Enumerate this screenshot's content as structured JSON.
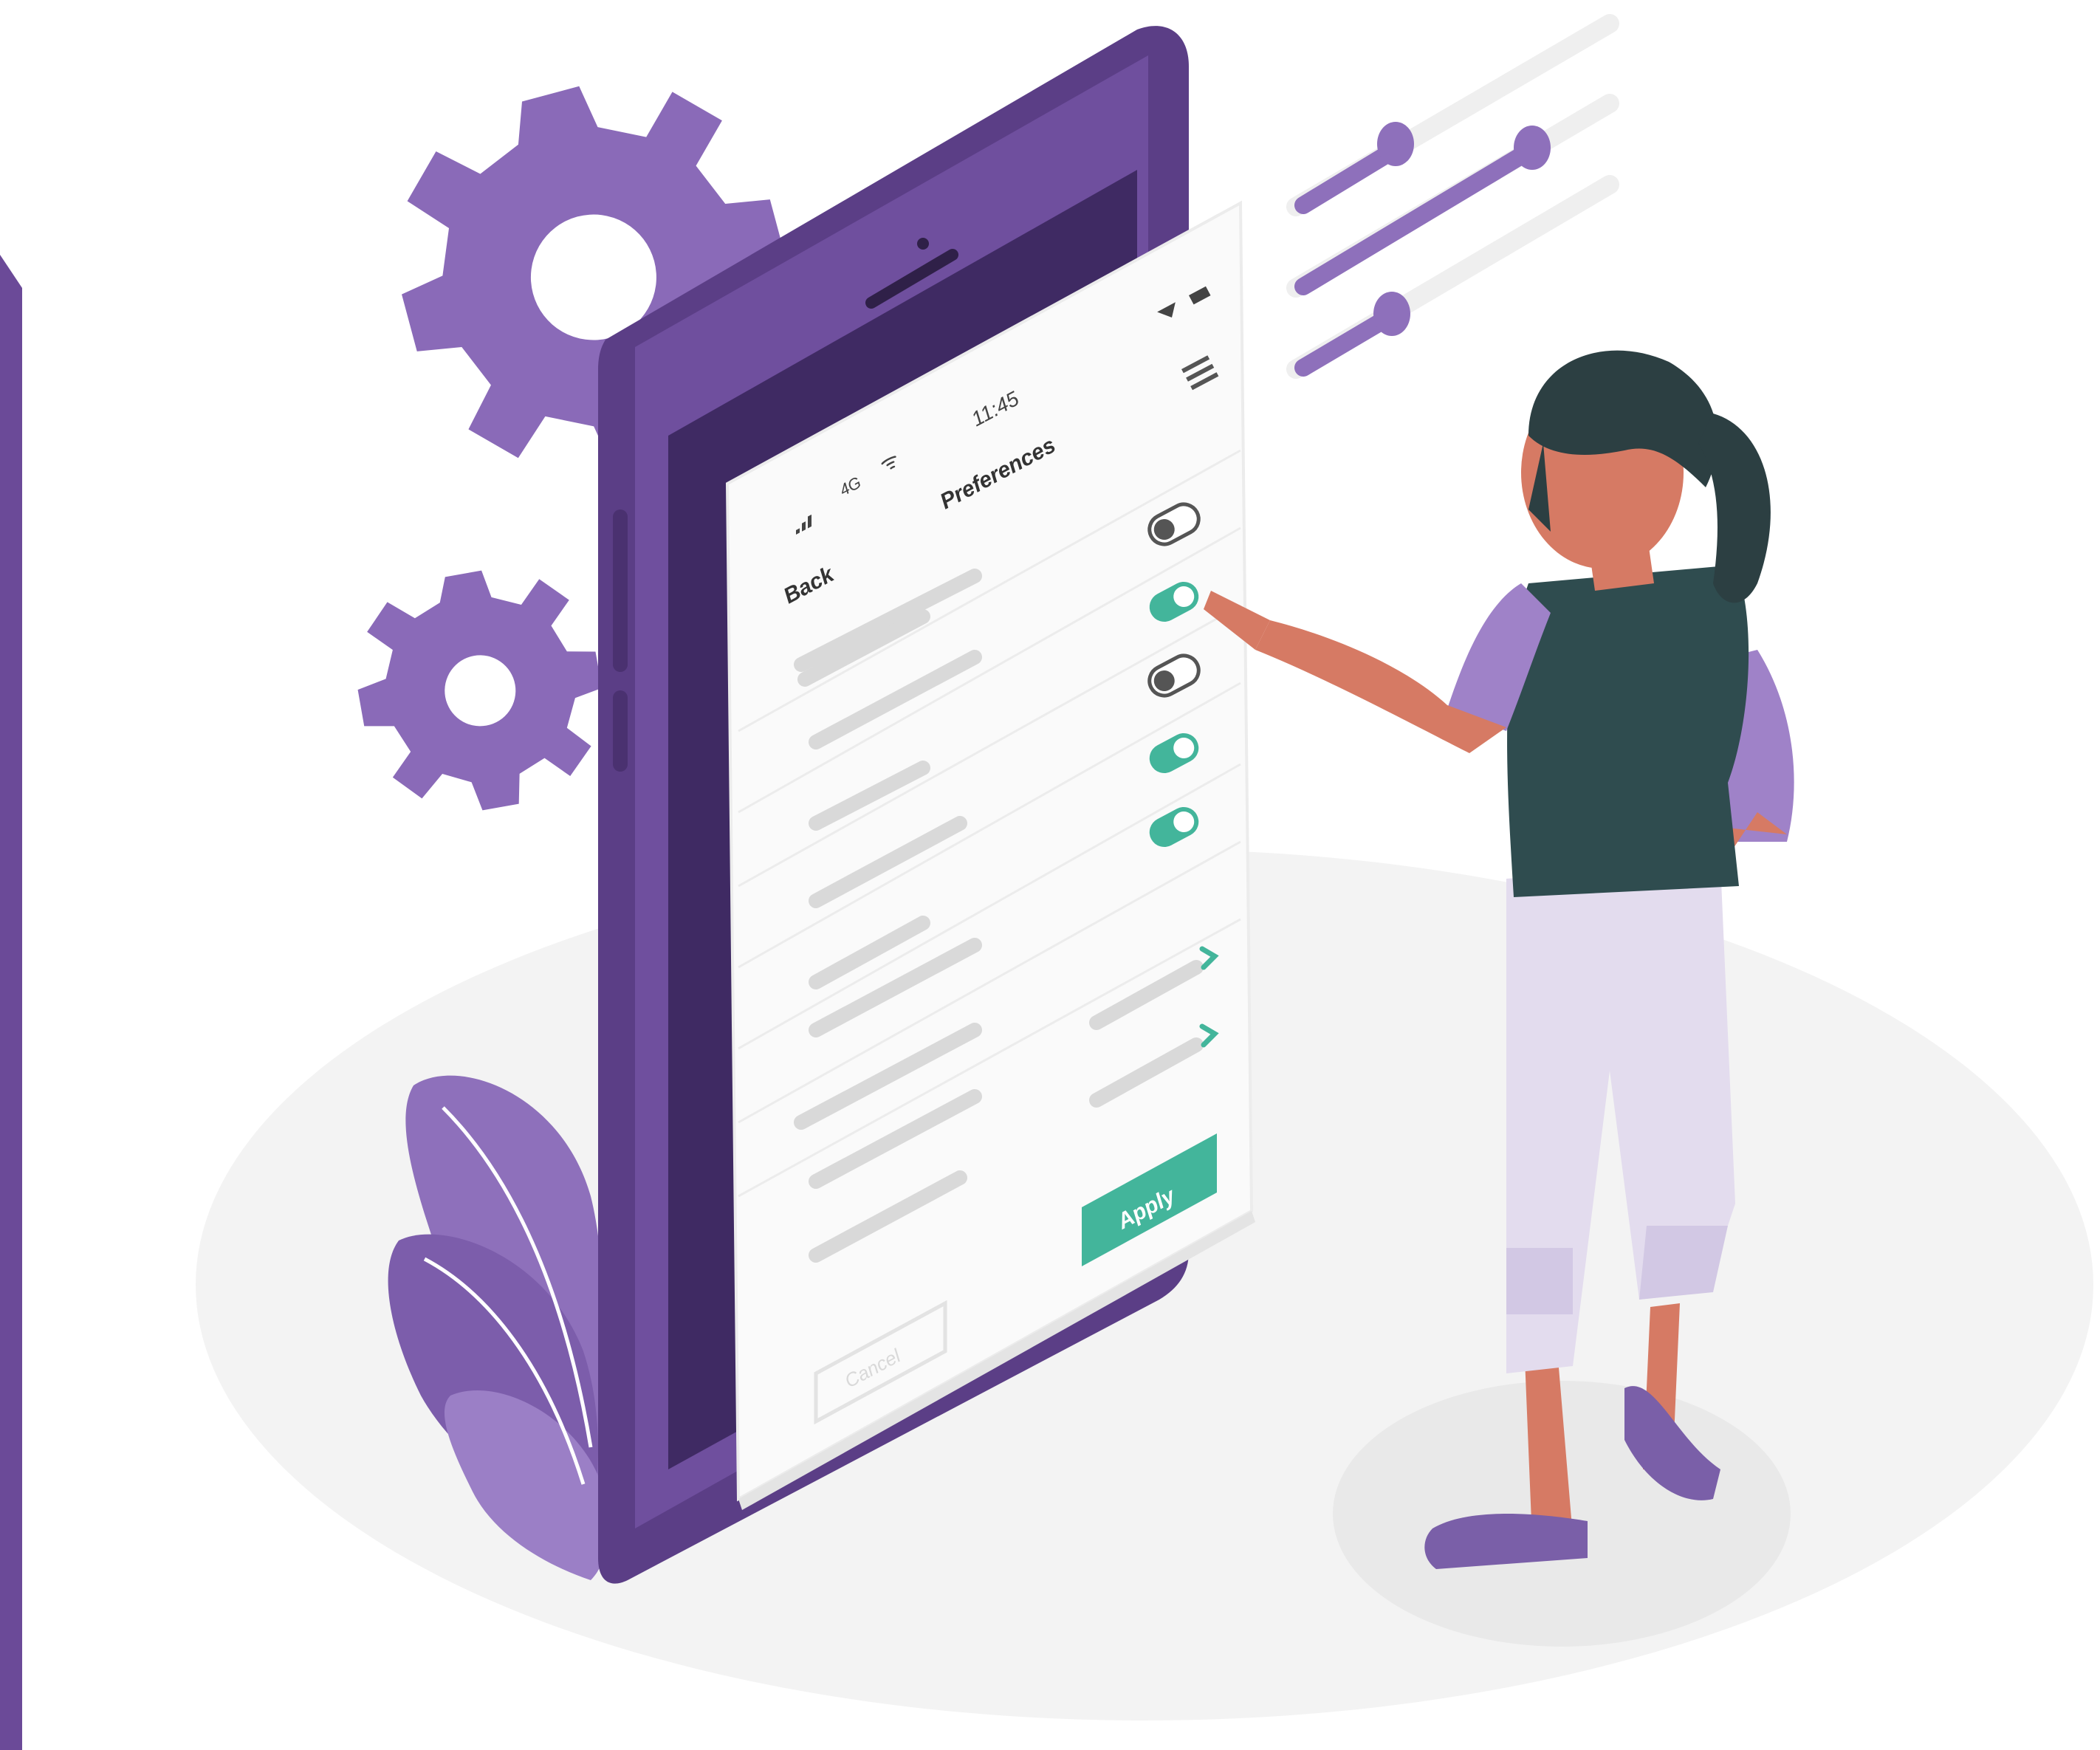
{
  "status_bar": {
    "signal_label": "4G",
    "time": "11:45"
  },
  "header": {
    "back_label": "Back",
    "title": "Preferences",
    "menu_icon": "hamburger-icon"
  },
  "settings": {
    "toggles": [
      {
        "state": "off"
      },
      {
        "state": "on"
      },
      {
        "state": "off"
      },
      {
        "state": "on"
      },
      {
        "state": "on"
      }
    ],
    "arrow_rows": [
      {
        "icon": "chevron-right-icon"
      },
      {
        "icon": "chevron-right-icon"
      }
    ]
  },
  "footer": {
    "apply_label": "Apply",
    "cancel_label": "Cancel"
  },
  "colors": {
    "accent_purple": "#7b5ba6",
    "dark_purple": "#5b3e86",
    "light_purple": "#9f82c8",
    "toggle_on": "#43b59b",
    "panel": "#fafafa"
  },
  "decor": {
    "icons": [
      "gear-icon",
      "slider-icon",
      "plant-icon",
      "person-illustration"
    ]
  }
}
